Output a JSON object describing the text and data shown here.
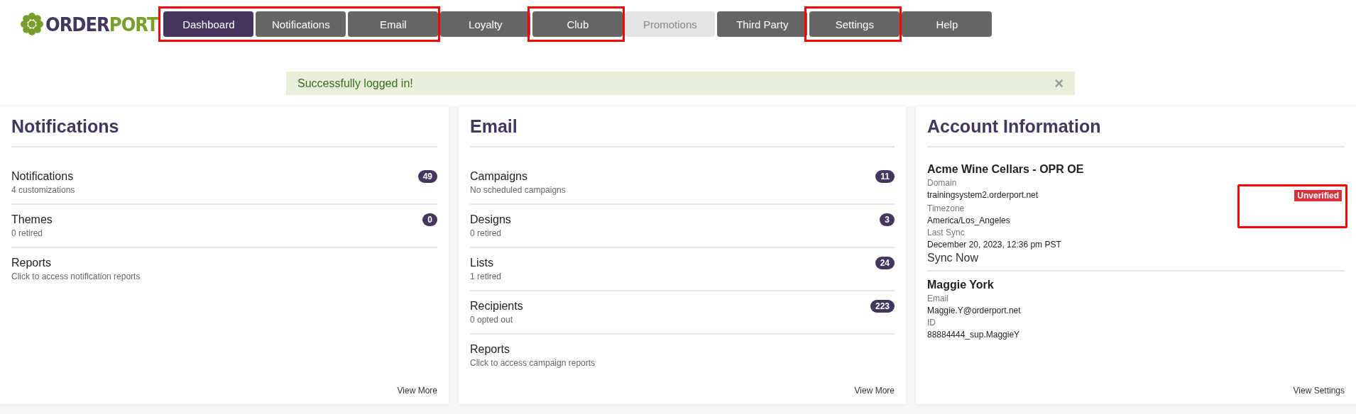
{
  "logo": {
    "first": "ORDER",
    "second": "PORT"
  },
  "nav_groups": [
    {
      "highlighted": true,
      "items": [
        {
          "label": "Dashboard",
          "selected": true,
          "disabled": false
        },
        {
          "label": "Notifications",
          "selected": false,
          "disabled": false
        },
        {
          "label": "Email",
          "selected": false,
          "disabled": false
        }
      ]
    },
    {
      "highlighted": false,
      "items": [
        {
          "label": "Loyalty",
          "selected": false,
          "disabled": false
        }
      ]
    },
    {
      "highlighted": true,
      "items": [
        {
          "label": "Club",
          "selected": false,
          "disabled": false
        }
      ]
    },
    {
      "highlighted": false,
      "items": [
        {
          "label": "Promotions",
          "selected": false,
          "disabled": true
        },
        {
          "label": "Third Party",
          "selected": false,
          "disabled": false
        }
      ]
    },
    {
      "highlighted": true,
      "items": [
        {
          "label": "Settings",
          "selected": false,
          "disabled": false
        }
      ]
    },
    {
      "highlighted": false,
      "items": [
        {
          "label": "Help",
          "selected": false,
          "disabled": false
        }
      ]
    }
  ],
  "alert": {
    "message": "Successfully logged in!",
    "close": "×"
  },
  "notifications_card": {
    "title": "Notifications",
    "items": [
      {
        "name": "Notifications",
        "detail": "4 customizations",
        "count": "49"
      },
      {
        "name": "Themes",
        "detail": "0 retired",
        "count": "0"
      },
      {
        "name": "Reports",
        "detail": "Click to access notification reports"
      }
    ],
    "footer_link": "View More"
  },
  "email_card": {
    "title": "Email",
    "items": [
      {
        "name": "Campaigns",
        "detail": "No scheduled campaigns",
        "count": "11"
      },
      {
        "name": "Designs",
        "detail": "0 retired",
        "count": "3"
      },
      {
        "name": "Lists",
        "detail": "1 retired",
        "count": "24"
      },
      {
        "name": "Recipients",
        "detail": "0 opted out",
        "count": "223"
      },
      {
        "name": "Reports",
        "detail": "Click to access campaign reports"
      }
    ],
    "footer_link": "View More"
  },
  "account_card": {
    "title": "Account Information",
    "account": {
      "name": "Acme Wine Cellars - OPR OE",
      "domain_label": "Domain",
      "domain": "trainingsystem2.orderport.net",
      "domain_status": {
        "label": "Unverified",
        "highlighted": true
      },
      "timezone_label": "Timezone",
      "timezone": "America/Los_Angeles",
      "last_sync_label": "Last Sync",
      "last_sync": "December 20, 2023, 12:36 pm PST",
      "sync_link": "Sync Now"
    },
    "user": {
      "name": "Maggie York",
      "email_label": "Email",
      "email": "Maggie.Y@orderport.net",
      "id_label": "ID",
      "id": "88884444_sup.MaggieY"
    },
    "footer_link": "View Settings"
  }
}
